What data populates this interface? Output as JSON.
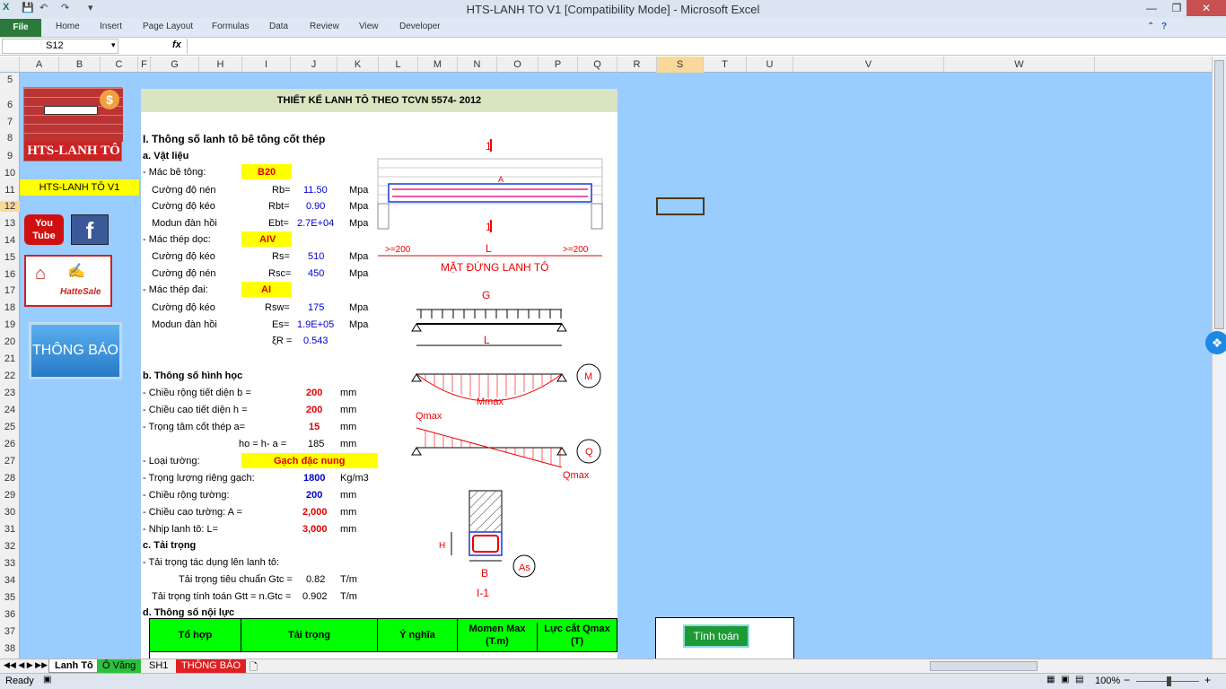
{
  "title": "HTS-LANH TO V1  [Compatibility Mode]  -  Microsoft Excel",
  "ribbon": {
    "file": "File",
    "tabs": [
      "Home",
      "Insert",
      "Page Layout",
      "Formulas",
      "Data",
      "Review",
      "View",
      "Developer"
    ]
  },
  "formula": {
    "name_box": "S12",
    "fx": "fx",
    "value": ""
  },
  "columns": [
    "A",
    "B",
    "C",
    "F",
    "G",
    "H",
    "I",
    "J",
    "K",
    "L",
    "M",
    "N",
    "O",
    "P",
    "Q",
    "R",
    "S",
    "T",
    "U",
    "V",
    "W"
  ],
  "rows": [
    "5",
    "6",
    "7",
    "8",
    "9",
    "10",
    "11",
    "12",
    "13",
    "14",
    "15",
    "16",
    "17",
    "18",
    "19",
    "20",
    "21",
    "22",
    "23",
    "24",
    "25",
    "26",
    "27",
    "28",
    "29",
    "30",
    "31",
    "32",
    "33",
    "34",
    "35",
    "36",
    "37",
    "38"
  ],
  "left": {
    "logo_text": "HTS-LANH TÔ",
    "version": "HTS-LANH TÔ V1",
    "youtube": "You Tube",
    "facebook": "f",
    "hatte": "HatteSale",
    "notice": "THÔNG BÁO"
  },
  "doc": {
    "title": "THIẾT KẾ LANH TÔ THEO TCVN 5574- 2012",
    "sec1": "I. Thông số lanh tô bê tông cốt thép",
    "a": "a. Vật liệu",
    "mac_bt": "- Mác bê tông:",
    "mac_bt_v": "B20",
    "cd_nen": "Cường độ nén",
    "rb": "Rb=",
    "rb_v": "11.50",
    "mpa": "Mpa",
    "cd_keo": "Cường độ kéo",
    "rbt": "Rbt=",
    "rbt_v": "0.90",
    "modun": "Modun đàn hồi",
    "ebt": "Ebt=",
    "ebt_v": "2.7E+04",
    "mac_td": "- Mác thép dọc:",
    "mac_td_v": "AIV",
    "rs": "Rs=",
    "rs_v": "510",
    "rsc": "Rsc=",
    "rsc_v": "450",
    "mac_tdai": "- Mác thép đai:",
    "mac_tdai_v": "AI",
    "rsw": "Rsw=",
    "rsw_v": "175",
    "es": "Es=",
    "es_v": "1.9E+05",
    "xi": "ξR =",
    "xi_v": "0.543",
    "b": "b. Thông số hình học",
    "b_l": "- Chiều rộng tiết diện  b =",
    "b_v": "200",
    "mm": "mm",
    "h_l": "- Chiều cao tiết diện    h =",
    "h_v": "200",
    "a_l": "- Trọng tâm cốt thép        a=",
    "a_v": "15",
    "ho_l": "ho = h- a =",
    "ho_v": "185",
    "loai": "- Loại tường:",
    "loai_v": "Gạch đặc nung",
    "tl": "- Trọng lượng riêng gạch:",
    "tl_v": "1800",
    "tl_u": "Kg/m3",
    "cr": "- Chiều rộng tường:",
    "cr_v": "200",
    "cc": "- Chiều cao tường:  A  =",
    "cc_v": "2,000",
    "nl": "- Nhịp lanh tô:  L=",
    "nl_v": "3,000",
    "c": "c. Tải trọng",
    "tt": "- Tải trọng tác dụng lên lanh tô:",
    "ttc": "Tải trọng tiêu chuẩn Gtc =",
    "ttc_v": "0.82",
    "tm": "T/m",
    "ttt": "Tải trọng tính toán Gtt = n.Gtc =",
    "ttt_v": "0.902",
    "d": "d. Thông số nội lực",
    "th": [
      "Tổ hợp",
      "Tải trọng",
      "Ý nghĩa",
      "Momen Max (T.m)",
      "Lực cắt Qmax (T)"
    ],
    "btn": "Tính toán",
    "diag": {
      "s1": "1",
      "mdl": "MẶT ĐỨNG LANH TÔ",
      "ge200": ">=200",
      "L": "L",
      "G": "G",
      "M": "M",
      "Mmax": "Mmax",
      "Q": "Q",
      "Qmax": "Qmax",
      "H": "H",
      "B": "B",
      "As": "As",
      "sec": "I-1",
      "Aa": "A"
    }
  },
  "sheets": [
    "Lanh Tô",
    "Ô Văng",
    "SH1",
    "THÔNG BÁO"
  ],
  "status": {
    "ready": "Ready",
    "zoom": "100%"
  }
}
